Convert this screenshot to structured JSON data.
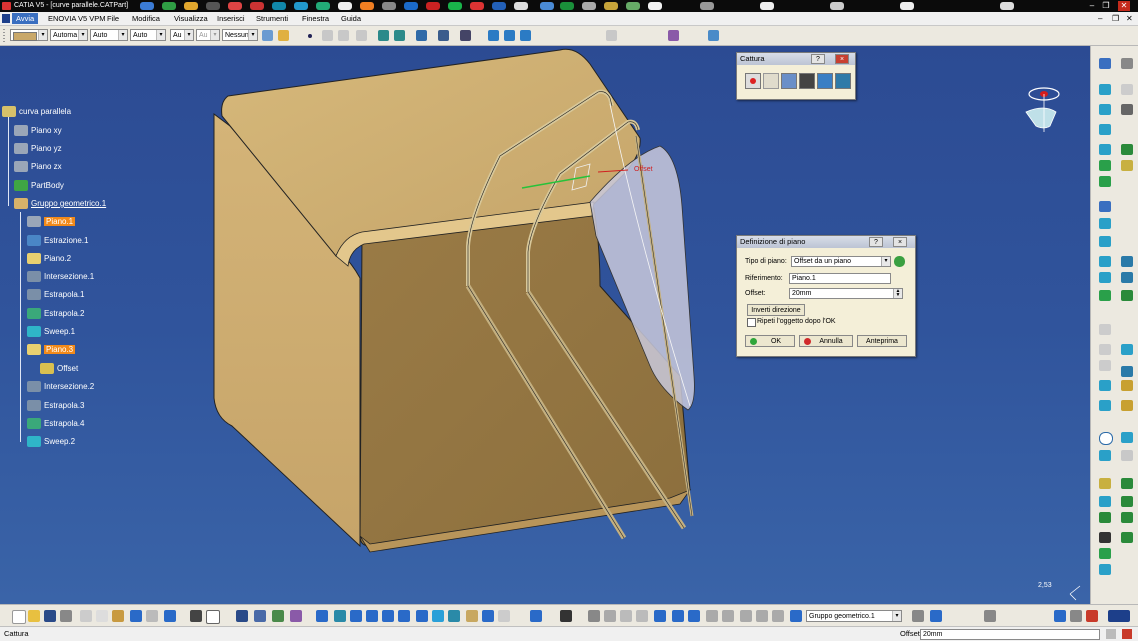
{
  "window": {
    "title": "CATIA V5 - [curve parallele.CATPart]"
  },
  "menu": {
    "items": [
      "Avvia",
      "ENOVIA V5 VPM",
      "File",
      "Modifica",
      "Visualizza",
      "Inserisci",
      "Strumenti",
      "Finestra",
      "Guida"
    ]
  },
  "toolbar": {
    "combo_color": "",
    "combo_1": "Automa",
    "combo_2": "Auto",
    "combo_3": "Auto",
    "combo_4": "Au",
    "combo_5": "Au",
    "combo_6": "Nessuno"
  },
  "tree": {
    "root": "curva parallela",
    "items": [
      {
        "label": "Piano xy"
      },
      {
        "label": "Piano yz"
      },
      {
        "label": "Piano zx"
      },
      {
        "label": "PartBody"
      },
      {
        "label": "Gruppo geometrico.1"
      },
      {
        "label": "Piano.1"
      },
      {
        "label": "Estrazione.1"
      },
      {
        "label": "Piano.2"
      },
      {
        "label": "Intersezione.1"
      },
      {
        "label": "Estrapola.1"
      },
      {
        "label": "Estrapola.2"
      },
      {
        "label": "Sweep.1"
      },
      {
        "label": "Piano.3"
      },
      {
        "label": "Offset"
      },
      {
        "label": "Intersezione.2"
      },
      {
        "label": "Estrapola.3"
      },
      {
        "label": "Estrapola.4"
      },
      {
        "label": "Sweep.2"
      }
    ]
  },
  "cattura": {
    "title": "Cattura",
    "help": "?",
    "close": "×"
  },
  "plane_dialog": {
    "title": "Definizione di piano",
    "help": "?",
    "close": "×",
    "type_label": "Tipo di piano:",
    "type_value": "Offset da un piano",
    "ref_label": "Riferimento:",
    "ref_value": "Piano.1",
    "offset_label": "Offset:",
    "offset_value": "20mm",
    "invert_button": "Inverti direzione",
    "repeat_label": "Ripeti l'oggetto dopo l'OK",
    "ok": "OK",
    "cancel": "Annulla",
    "preview": "Anteprima"
  },
  "viewport": {
    "offset_tag": "Offset",
    "scale_readout": "2,53"
  },
  "bottom": {
    "current_set": "Gruppo geometrico.1"
  },
  "status": {
    "left_text": "Cattura",
    "offset_label": "Offset",
    "offset_value": "20mm"
  },
  "colors": {
    "viewport_top": "#2c4b93",
    "part_fill": "#c9a86a",
    "selection": "#f28a1a"
  }
}
